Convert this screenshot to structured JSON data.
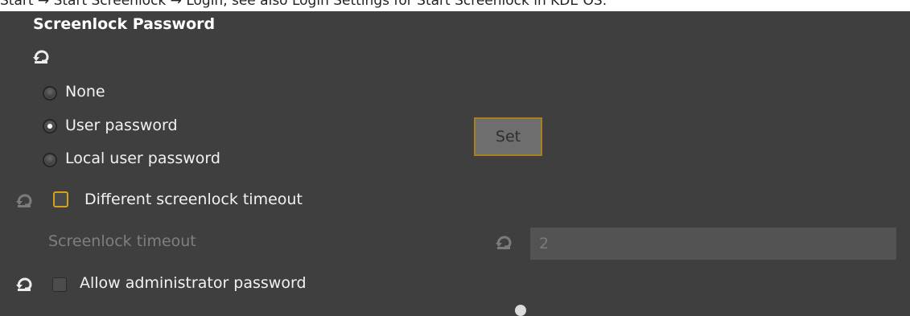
{
  "top_caption": {
    "text": "Start → Start Screenlock → Login, see also Login Settings for Start Screenlock in KDE OS."
  },
  "section": {
    "title": "Screenlock Password"
  },
  "radio_group": {
    "options": [
      {
        "label": "None",
        "checked": false
      },
      {
        "label": "User password",
        "checked": true
      },
      {
        "label": "Local user password",
        "checked": false
      }
    ]
  },
  "set_button": {
    "label": "Set"
  },
  "different_timeout": {
    "label": "Different screenlock timeout",
    "checked": false
  },
  "screenlock_timeout": {
    "label": "Screenlock timeout",
    "value": "2"
  },
  "allow_admin": {
    "label": "Allow administrator password",
    "checked": false
  },
  "colors": {
    "background": "#3f3f3f",
    "focus_accent": "#d6a21c",
    "text": "#f2f2f2",
    "disabled_text": "#7f7f7f"
  },
  "icons": [
    "reset-icon",
    "radio-icon",
    "checkbox-icon"
  ]
}
